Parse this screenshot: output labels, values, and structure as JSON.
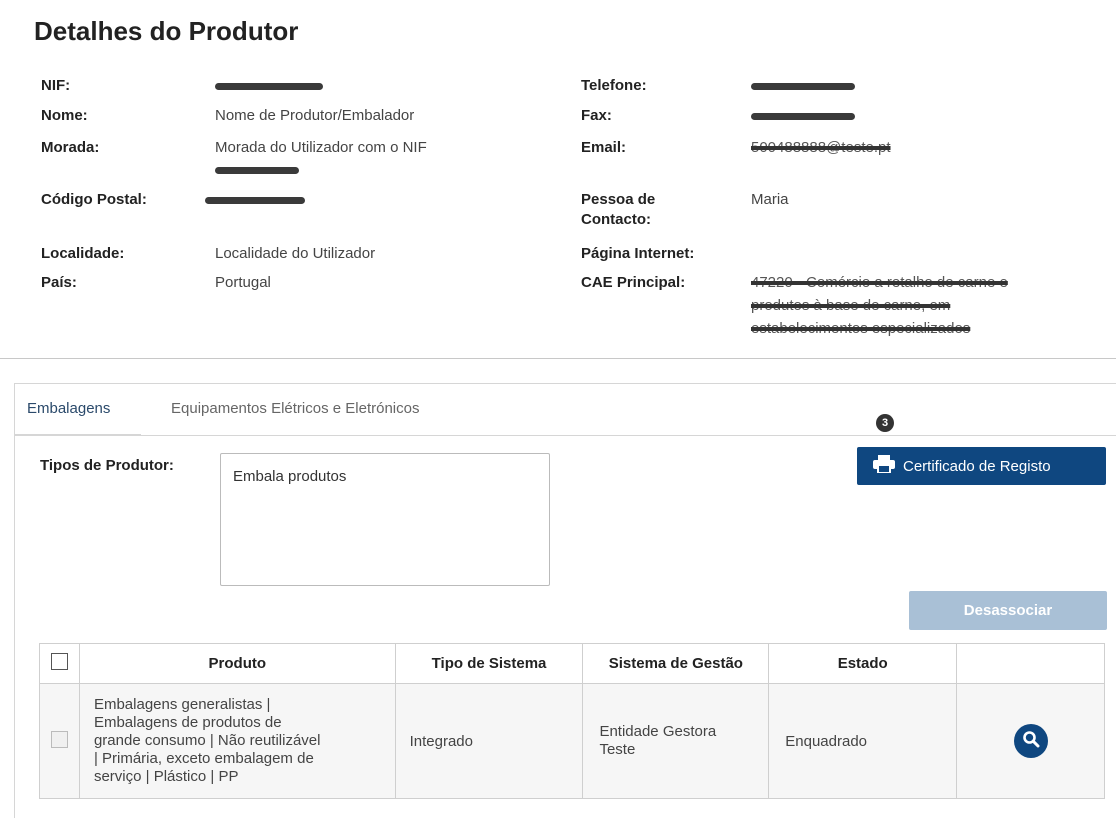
{
  "page_title": "Detalhes do Produtor",
  "details": {
    "nif_label": "NIF:",
    "nome_label": "Nome:",
    "nome_value": "Nome de Produtor/Embalador",
    "morada_label": "Morada:",
    "morada_value": "Morada do Utilizador com o NIF",
    "codigo_postal_label": "Código Postal:",
    "localidade_label": "Localidade:",
    "localidade_value": "Localidade do Utilizador",
    "pais_label": "País:",
    "pais_value": "Portugal",
    "telefone_label": "Telefone:",
    "fax_label": "Fax:",
    "email_label": "Email:",
    "pessoa_contacto_label_1": "Pessoa de",
    "pessoa_contacto_label_2": "Contacto:",
    "pessoa_contacto_value": "Maria",
    "pagina_internet_label": "Página Internet:",
    "cae_label": "CAE Principal:",
    "cae_value_line1": "47220 - Comércio a retalho de carne e",
    "cae_value_line2": "produtos à base de carne, em",
    "cae_value_line3": "estabelecimentos especializados",
    "email_value": "500488888@teste.pt"
  },
  "tabs": [
    {
      "label": "Embalagens"
    },
    {
      "label": "Equipamentos Elétricos e Eletrónicos"
    }
  ],
  "step_badge": "3",
  "certificado_button": "Certificado de Registo",
  "tipos_produtor_label": "Tipos de Produtor:",
  "tipos_produtor_value": "Embala produtos",
  "desassociar_button": "Desassociar",
  "table": {
    "headers": [
      "Produto",
      "Tipo de Sistema",
      "Sistema de Gestão",
      "Estado"
    ],
    "rows": [
      {
        "produto_1": "Embalagens generalistas |",
        "produto_2": "Embalagens de produtos de",
        "produto_3": "grande consumo | Não reutilizável",
        "produto_4": "| Primária, exceto embalagem de",
        "produto_5": "serviço | Plástico | PP",
        "tipo_sistema": "Integrado",
        "sistema_gestao_1": "Entidade Gestora",
        "sistema_gestao_2": "Teste",
        "estado": "Enquadrado"
      }
    ]
  },
  "icons": {
    "print": "printer-icon",
    "search": "search-icon"
  },
  "colors": {
    "primary": "#0f4780",
    "disabled": "#a9c0d6"
  }
}
